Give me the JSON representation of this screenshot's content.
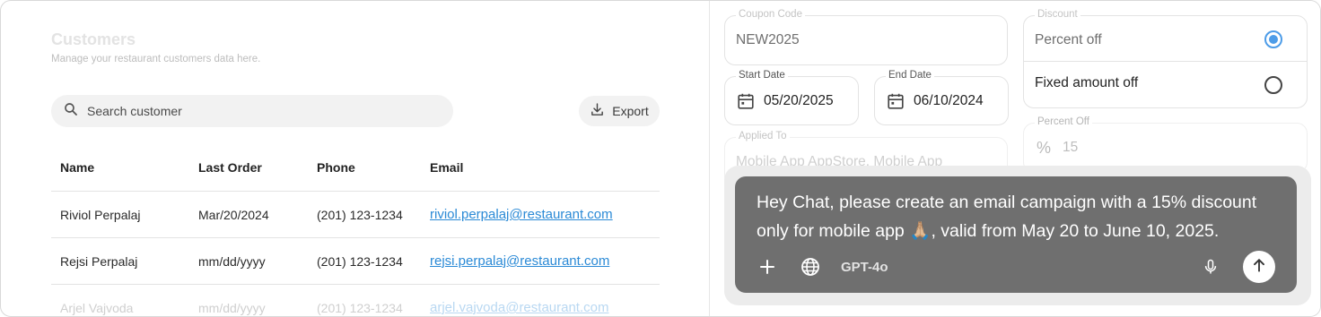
{
  "customers": {
    "title": "Customers",
    "subtitle": "Manage your restaurant customers data here.",
    "search": {
      "placeholder": "Search customer"
    },
    "export_label": "Export",
    "columns": [
      "Name",
      "Last Order",
      "Phone",
      "Email"
    ],
    "rows": [
      {
        "name": "Riviol Perpalaj",
        "last_order": "Mar/20/2024",
        "phone": "(201) 123-1234",
        "email": "riviol.perpalaj@restaurant.com"
      },
      {
        "name": "Rejsi Perpalaj",
        "last_order": "mm/dd/yyyy",
        "phone": "(201) 123-1234",
        "email": "rejsi.perpalaj@restaurant.com"
      },
      {
        "name": "Arjel Vajvoda",
        "last_order": "mm/dd/yyyy",
        "phone": "(201) 123-1234",
        "email": "arjel.vajvoda@restaurant.com"
      }
    ]
  },
  "coupon_form": {
    "coupon_code": {
      "label": "Coupon Code",
      "value": "NEW2025"
    },
    "discount": {
      "label": "Discount",
      "options": [
        {
          "label": "Percent off",
          "selected": true
        },
        {
          "label": "Fixed amount off",
          "selected": false
        }
      ]
    },
    "start_date": {
      "label": "Start Date",
      "value": "05/20/2025"
    },
    "end_date": {
      "label": "End Date",
      "value": "06/10/2024"
    },
    "applied_to": {
      "label": "Applied To",
      "value": "Mobile App AppStore, Mobile App"
    },
    "percent_off": {
      "label": "Percent Off",
      "value": "15",
      "prefix": "%"
    }
  },
  "chat": {
    "message": "Hey Chat, please create an email campaign with a 15% discount only for mobile app 🙏🏼, valid from May 20 to June 10, 2025.",
    "model": "GPT-4o"
  },
  "colors": {
    "accent": "#4d9ce8",
    "link": "#2b8ad6",
    "chat_bg": "#6f6f6f"
  }
}
